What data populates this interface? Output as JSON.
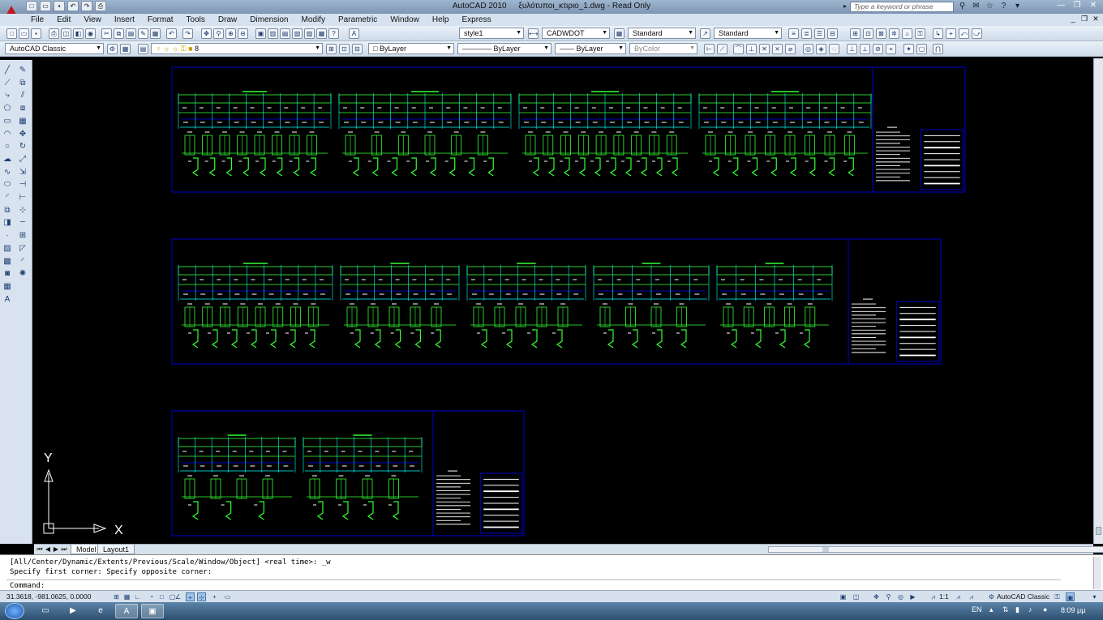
{
  "window": {
    "app_name": "AutoCAD 2010",
    "doc_title": "ξυλότυποι_κτιριο_1.dwg - Read Only",
    "search_placeholder": "Type a keyword or phrase"
  },
  "menu": [
    "File",
    "Edit",
    "View",
    "Insert",
    "Format",
    "Tools",
    "Draw",
    "Dimension",
    "Modify",
    "Parametric",
    "Window",
    "Help",
    "Express"
  ],
  "toolbar1": {
    "text_style": "style1",
    "dim_style": "CADWDOT",
    "table_style": "Standard",
    "multileader_style": "Standard"
  },
  "toolbar2": {
    "workspace": "AutoCAD Classic",
    "layer": "8",
    "color": "ByLayer",
    "linetype": "ByLayer",
    "lineweight": "ByLayer",
    "plotstyle": "ByColor"
  },
  "ucs": {
    "y_label": "Y",
    "x_label": "X"
  },
  "tabs": {
    "model": "Model",
    "layout1": "Layout1"
  },
  "command": {
    "line1": "[All/Center/Dynamic/Extents/Previous/Scale/Window/Object] <real time>: _w",
    "line2": "Specify first corner: Specify opposite corner:",
    "prompt": "Command:"
  },
  "status": {
    "coords": "31.3618, -981.0625, 0.0000",
    "annotation_scale": "1:1",
    "workspace": "AutoCAD Classic"
  },
  "taskbar": {
    "lang": "EN",
    "time": "8:09 μμ"
  },
  "colors": {
    "drawing_green": "#33ff33",
    "drawing_cyan": "#00ffff",
    "drawing_blue": "#0000ff",
    "drawing_white": "#ffffff",
    "drawing_yellow": "#ffff00",
    "ui_bg": "#d6e2f0"
  }
}
